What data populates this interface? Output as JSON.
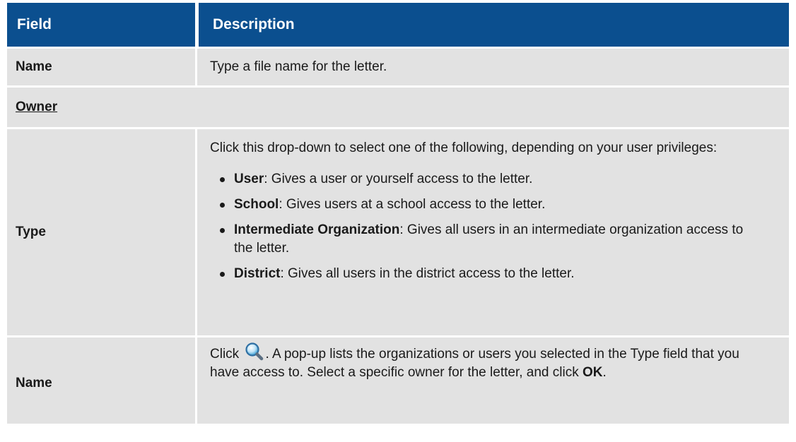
{
  "header": {
    "field": "Field",
    "description": "Description"
  },
  "rows": {
    "name_row": {
      "field": "Name",
      "description": "Type a file name for the letter."
    },
    "owner_section": "Owner",
    "type_row": {
      "field": "Type",
      "intro": "Click this drop-down to select one of the following, depending on your user privileges:",
      "bullets": [
        {
          "term": "User",
          "text": ": Gives a user or yourself access to the letter."
        },
        {
          "term": "School",
          "text": ": Gives users at a school access to the letter."
        },
        {
          "term": "Intermediate Organization",
          "text": ": Gives all users in an intermediate organization access to the letter."
        },
        {
          "term": "District",
          "text": ": Gives all users in the district access to the letter."
        }
      ]
    },
    "owner_name_row": {
      "field": "Name",
      "desc_prefix": "Click",
      "icon": "magnifier-icon",
      "desc_middle": ". A pop-up lists the organizations or users you selected in the Type field that you have access to. Select a specific owner for the letter, and click ",
      "ok": "OK",
      "desc_suffix": "."
    }
  },
  "colors": {
    "header_bg": "#0b4f8f",
    "row_bg": "#e2e2e2"
  }
}
